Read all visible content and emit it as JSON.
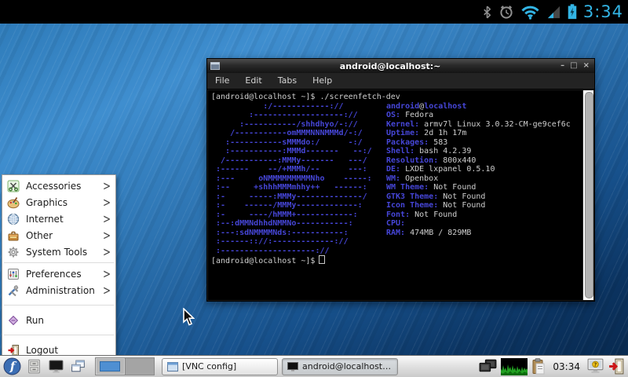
{
  "colors": {
    "android_accent": "#33b5e5",
    "terminal_blue": "#4646d8",
    "terminal_fg": "#cfcfcf",
    "fedora_blue": "#3c6eb4",
    "wallpaper_top": "#3f8ecf",
    "wallpaper_bottom": "#082a50"
  },
  "status_bar": {
    "time": "3:34",
    "icons": [
      "bluetooth-icon",
      "alarm-clock-icon",
      "wifi-icon",
      "signal-icon",
      "battery-charging-icon"
    ]
  },
  "terminal_window": {
    "title": "android@localhost:~",
    "menu": [
      "File",
      "Edit",
      "Tabs",
      "Help"
    ],
    "controls": [
      "minimize",
      "maximize",
      "close"
    ],
    "command_line": "[android@localhost ~]$ ./screenfetch-dev",
    "prompt": "[android@localhost ~]$",
    "screenfetch": [
      {
        "art": "           :/------------://",
        "user": "android",
        "host": "localhost"
      },
      {
        "art": "        :-------------------://",
        "label": "OS:",
        "value": "Fedora"
      },
      {
        "art": "      :-----------/shhdhyo/-://",
        "label": "Kernel:",
        "value": "armv7l Linux 3.0.32-CM-ge9cef6c"
      },
      {
        "art": "    /-----------omMMMNNNMMMd/-:/",
        "label": "Uptime:",
        "value": "2d 1h 17m"
      },
      {
        "art": "   :-----------sMMMdo:/      -:/",
        "label": "Packages:",
        "value": "583"
      },
      {
        "art": "   :-----------:MMMd-------   --:/",
        "label": "Shell:",
        "value": "bash 4.2.39"
      },
      {
        "art": "  /-----------:MMMy-------   ---/",
        "label": "Resolution:",
        "value": "800x440"
      },
      {
        "art": " :------    --/+MMMh/--      ---:",
        "label": "DE:",
        "value": "LXDE lxpanel 0.5.10"
      },
      {
        "art": " :---     oNMMMMMMMMMNho    -----:",
        "label": "WM:",
        "value": "Openbox"
      },
      {
        "art": " :--     +shhhMMMmhhy++   ------:",
        "label": "WM Theme:",
        "value": "Not Found"
      },
      {
        "art": " :-     -----:MMMy--------------/",
        "label": "GTK3 Theme:",
        "value": "Not Found"
      },
      {
        "art": " :-    ------/MMMy-------------:",
        "label": "Icon Theme:",
        "value": "Not Found"
      },
      {
        "art": " :-     ----/hMMM+------------:",
        "label": "Font:",
        "value": "Not Found"
      },
      {
        "art": " :--:dMMNdhhdNMMNo-----------:",
        "label": "CPU:",
        "value": ""
      },
      {
        "art": " :---:sdNMMMMNds:-----------:",
        "label": "RAM:",
        "value": "474MB / 829MB"
      },
      {
        "art": " :------:://:-------------://"
      },
      {
        "art": " :--------------------://"
      }
    ]
  },
  "app_menu": {
    "items": [
      {
        "label": "Accessories",
        "icon": "scissors-icon",
        "submenu": true
      },
      {
        "label": "Graphics",
        "icon": "palette-icon",
        "submenu": true
      },
      {
        "label": "Internet",
        "icon": "globe-icon",
        "submenu": true
      },
      {
        "label": "Other",
        "icon": "toolbox-icon",
        "submenu": true
      },
      {
        "label": "System Tools",
        "icon": "gear-icon",
        "submenu": true
      },
      {
        "separator": true
      },
      {
        "label": "Preferences",
        "icon": "preferences-icon",
        "submenu": true
      },
      {
        "label": "Administration",
        "icon": "admin-tools-icon",
        "submenu": true
      },
      {
        "separator": true,
        "wide": true
      },
      {
        "label": "Run",
        "icon": "run-diamond-icon",
        "submenu": false
      },
      {
        "separator": true,
        "wide": true
      },
      {
        "label": "Logout",
        "icon": "logout-door-icon",
        "submenu": false
      }
    ]
  },
  "taskbar": {
    "launchers": [
      {
        "name": "menu-button",
        "icon": "fedora-logo-icon"
      },
      {
        "name": "file-manager-launcher",
        "icon": "file-cabinet-icon"
      },
      {
        "name": "terminal-launcher",
        "icon": "black-monitor-icon"
      },
      {
        "name": "iconify-windows-button",
        "icon": "windows-overlap-icon"
      }
    ],
    "workspaces": [
      {
        "active": true,
        "has_window": true
      },
      {
        "active": false,
        "has_window": false
      }
    ],
    "tasks": [
      {
        "label": "[VNC config]",
        "icon": "window-icon",
        "active": false
      },
      {
        "label": "android@localhost:~",
        "icon": "terminal-icon",
        "active": true
      }
    ],
    "tray": [
      "network-monitors-icon",
      "cpu-graph-icon",
      "clipboard-icon"
    ],
    "clock": "03:34",
    "right_buttons": [
      "screensaver-lock-icon",
      "logout-icon"
    ]
  }
}
